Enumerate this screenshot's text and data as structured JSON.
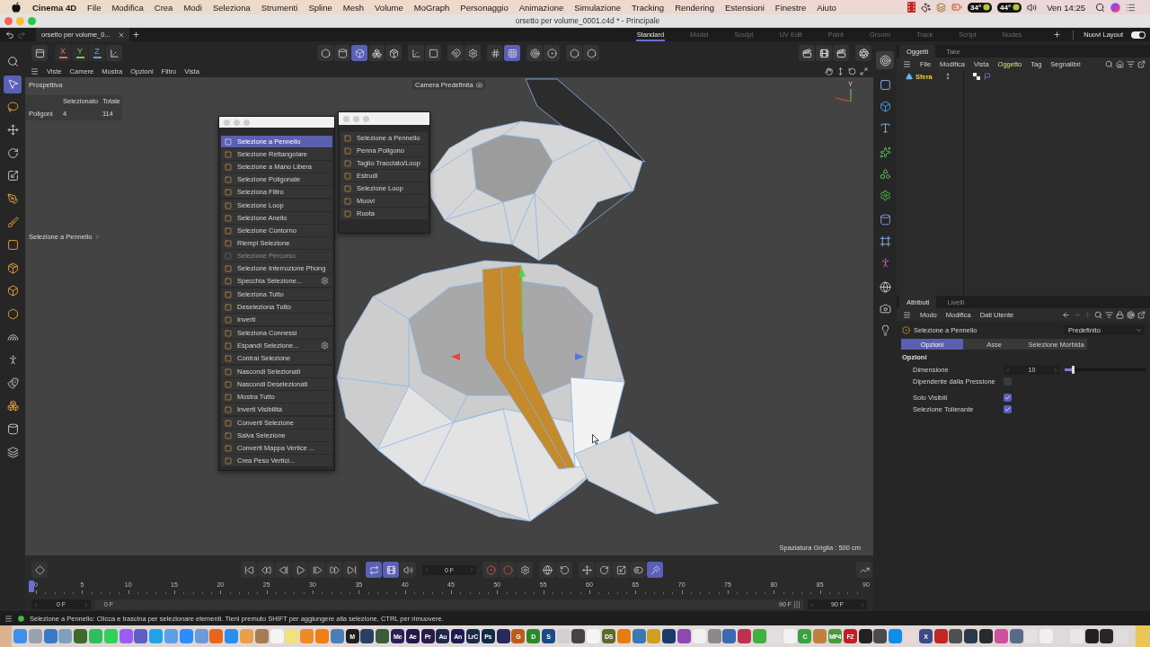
{
  "menu_bar": {
    "app": "Cinema 4D",
    "menus": [
      "File",
      "Modifica",
      "Crea",
      "Modi",
      "Seleziona",
      "Strumenti",
      "Spline",
      "Mesh",
      "Volume",
      "MoGraph",
      "Personaggio",
      "Animazione",
      "Simulazione",
      "Tracking",
      "Rendering",
      "Estensioni",
      "Finestre",
      "Aiuto"
    ],
    "sensors": [
      "34°",
      "44°"
    ],
    "clock": "Ven 14:25"
  },
  "window": {
    "title": "orsetto per volume_0001.c4d * - Principale"
  },
  "doc_tabs": [
    {
      "label": "orsetto per volume_0...",
      "selected": true
    }
  ],
  "layouts": [
    {
      "label": "Standard",
      "selected": true
    },
    {
      "label": "Model",
      "selected": false
    },
    {
      "label": "Sculpt",
      "selected": false
    },
    {
      "label": "UV Edit",
      "selected": false
    },
    {
      "label": "Paint",
      "selected": false
    },
    {
      "label": "Groom",
      "selected": false
    },
    {
      "label": "Track",
      "selected": false
    },
    {
      "label": "Script",
      "selected": false
    },
    {
      "label": "Nodes",
      "selected": false
    }
  ],
  "layout_switch": {
    "label": "Nuovi Layout",
    "on": true
  },
  "left_tools": [
    {
      "kind": "search",
      "selected": false
    },
    {
      "kind": "cursor",
      "selected": true
    },
    {
      "kind": "lasso",
      "selected": false
    },
    {
      "kind": "move",
      "selected": false
    },
    {
      "kind": "rotate",
      "selected": false
    },
    {
      "kind": "scale",
      "selected": false
    },
    {
      "kind": "pen",
      "selected": false
    },
    {
      "kind": "brush",
      "selected": false
    },
    {
      "kind": "square",
      "selected": false
    },
    {
      "kind": "package",
      "selected": false
    },
    {
      "kind": "cube",
      "selected": false
    },
    {
      "kind": "hexagon",
      "selected": false
    },
    {
      "kind": "arch",
      "selected": false
    },
    {
      "kind": "person",
      "selected": false
    },
    {
      "kind": "mask",
      "selected": false
    },
    {
      "kind": "boxes",
      "selected": false
    },
    {
      "kind": "cylinder",
      "selected": false
    },
    {
      "kind": "layers",
      "selected": false
    }
  ],
  "viewport": {
    "axis_locks": [
      {
        "label": "X",
        "color": "#e46a6a"
      },
      {
        "label": "Y",
        "color": "#7cc85a"
      },
      {
        "label": "Z",
        "color": "#6a9ae8"
      }
    ],
    "mode_groups": [
      [
        {
          "kind": "hexagon",
          "selected": false
        },
        {
          "kind": "cylinder",
          "selected": false
        },
        {
          "kind": "cube",
          "selected": true
        },
        {
          "kind": "boxes",
          "selected": false
        },
        {
          "kind": "package",
          "selected": false
        }
      ],
      [
        {
          "kind": "axis",
          "selected": false
        },
        {
          "kind": "square",
          "selected": false
        }
      ],
      [
        {
          "kind": "magnet",
          "selected": false
        },
        {
          "kind": "settings",
          "selected": false
        }
      ],
      [
        {
          "kind": "hash",
          "selected": false
        },
        {
          "kind": "grid",
          "selected": true
        }
      ],
      [
        {
          "kind": "target",
          "selected": false
        },
        {
          "kind": "circledot",
          "selected": false
        }
      ],
      [
        {
          "kind": "hexagon",
          "selected": false
        },
        {
          "kind": "hexagon",
          "selected": false
        }
      ]
    ],
    "menus": [
      "Viste",
      "Camere",
      "Mostra",
      "Opzioni",
      "Filtro",
      "Vista"
    ],
    "view_name": "Prospettiva",
    "camera": "Camera Predefinita",
    "stats": {
      "columns": [
        "Selezionato",
        "Totale"
      ],
      "rows": [
        {
          "label": "Poligoni",
          "values": [
            "4",
            "114"
          ]
        }
      ]
    },
    "tool_hint": "Selezione a Pennello",
    "gizmo_label": "Y",
    "grid_spacing": "Spaziatura Griglia : 500 cm"
  },
  "palettes": [
    {
      "groups": [
        [
          {
            "label": "Selezione a Pennello",
            "selected": true,
            "disabled": false,
            "settings": false
          },
          {
            "label": "Selezione Rettangolare",
            "selected": false,
            "disabled": false,
            "settings": false
          },
          {
            "label": "Selezione a Mano Libera",
            "selected": false,
            "disabled": false,
            "settings": false
          },
          {
            "label": "Selezione Poligonale",
            "selected": false,
            "disabled": false,
            "settings": false
          },
          {
            "label": "Seleziona Filtro",
            "selected": false,
            "disabled": false,
            "settings": false
          }
        ],
        [
          {
            "label": "Selezione Loop",
            "selected": false,
            "disabled": false,
            "settings": false
          },
          {
            "label": "Selezione Anello",
            "selected": false,
            "disabled": false,
            "settings": false
          },
          {
            "label": "Selezione Contorno",
            "selected": false,
            "disabled": false,
            "settings": false
          },
          {
            "label": "Riempi Selezione",
            "selected": false,
            "disabled": false,
            "settings": false
          },
          {
            "label": "Selezione Percorso",
            "selected": false,
            "disabled": true,
            "settings": false
          },
          {
            "label": "Selezione Interruzione Phong",
            "selected": false,
            "disabled": false,
            "settings": false
          },
          {
            "label": "Specchia Selezione...",
            "selected": false,
            "disabled": false,
            "settings": true
          }
        ],
        [
          {
            "label": "Seleziona Tutto",
            "selected": false,
            "disabled": false,
            "settings": false
          },
          {
            "label": "Deseleziona Tutto",
            "selected": false,
            "disabled": false,
            "settings": false
          },
          {
            "label": "Inverti",
            "selected": false,
            "disabled": false,
            "settings": false
          }
        ],
        [
          {
            "label": "Seleziona Connessi",
            "selected": false,
            "disabled": false,
            "settings": false
          },
          {
            "label": "Espandi Selezione...",
            "selected": false,
            "disabled": false,
            "settings": true
          },
          {
            "label": "Contrai Selezione",
            "selected": false,
            "disabled": false,
            "settings": false
          }
        ],
        [
          {
            "label": "Nascondi Selezionati",
            "selected": false,
            "disabled": false,
            "settings": false
          },
          {
            "label": "Nascondi Deselezionati",
            "selected": false,
            "disabled": false,
            "settings": false
          },
          {
            "label": "Mostra Tutto",
            "selected": false,
            "disabled": false,
            "settings": false
          },
          {
            "label": "Inverti Visibilità",
            "selected": false,
            "disabled": false,
            "settings": false
          }
        ],
        [
          {
            "label": "Converti Selezione",
            "selected": false,
            "disabled": false,
            "settings": false
          },
          {
            "label": "Salva Selezione",
            "selected": false,
            "disabled": false,
            "settings": false
          },
          {
            "label": "Converti Mappa Vertice ...",
            "selected": false,
            "disabled": false,
            "settings": false
          },
          {
            "label": "Crea Peso Vertici...",
            "selected": false,
            "disabled": false,
            "settings": false
          }
        ]
      ]
    },
    {
      "groups": [
        [
          {
            "label": "Selezione a Pennello",
            "selected": false
          },
          {
            "label": "Penna Poligono",
            "selected": false
          },
          {
            "label": "Taglio Tracciato/Loop",
            "selected": false
          },
          {
            "label": "Estrudi",
            "selected": false
          },
          {
            "label": "Selezione Loop",
            "selected": false
          },
          {
            "label": "Muovi",
            "selected": false
          },
          {
            "label": "Ruota",
            "selected": false
          }
        ]
      ]
    }
  ],
  "right_tools": [
    [
      {
        "kind": "target",
        "selected": true
      }
    ],
    [
      {
        "kind": "outline",
        "selected": false
      },
      {
        "kind": "primitive",
        "selected": false
      },
      {
        "kind": "text",
        "selected": false
      }
    ],
    [
      {
        "kind": "sparkles",
        "selected": false
      },
      {
        "kind": "shapes",
        "selected": false
      },
      {
        "kind": "gear",
        "selected": false
      }
    ],
    [
      {
        "kind": "capsule",
        "selected": false
      },
      {
        "kind": "frame",
        "selected": false
      },
      {
        "kind": "figure",
        "selected": false
      }
    ],
    [
      {
        "kind": "globe",
        "selected": false
      },
      {
        "kind": "camera",
        "selected": false
      },
      {
        "kind": "light",
        "selected": false
      }
    ]
  ],
  "objects_panel": {
    "tabs": [
      {
        "label": "Oggetti",
        "selected": true
      },
      {
        "label": "Take",
        "selected": false
      }
    ],
    "menus": [
      {
        "label": "File",
        "active": false
      },
      {
        "label": "Modifica",
        "active": false
      },
      {
        "label": "Vista",
        "active": false
      },
      {
        "label": "Oggetto",
        "active": true
      },
      {
        "label": "Tag",
        "active": false
      },
      {
        "label": "Segnalibri",
        "active": false
      }
    ],
    "objects": [
      {
        "label": "Sfera",
        "selected": true
      }
    ]
  },
  "attributes_panel": {
    "tabs": [
      {
        "label": "Attributi",
        "selected": true
      },
      {
        "label": "Livelli",
        "selected": false
      }
    ],
    "menus": [
      "Modo",
      "Modifica",
      "Dati Utente"
    ],
    "tool": "Selezione a Pennello",
    "preset": "Predefinito",
    "subtabs": [
      {
        "label": "Opzioni",
        "selected": true
      },
      {
        "label": "Asse",
        "selected": false
      },
      {
        "label": "Selezione Morbida",
        "selected": false
      }
    ],
    "section": "Opzioni",
    "field_groups": [
      [
        {
          "kind": "slider",
          "label": "Dimensione",
          "value": "10",
          "level": 0.1
        },
        {
          "kind": "checkbox",
          "label": "Dipendente dalla Pressione",
          "checked": false
        }
      ],
      [
        {
          "kind": "checkbox",
          "label": "Solo Visibili",
          "checked": true
        },
        {
          "kind": "checkbox",
          "label": "Selezione Tollerante",
          "checked": true
        }
      ]
    ]
  },
  "timeline": {
    "groups": [
      [
        {
          "kind": "key",
          "selected": false
        }
      ],
      [
        {
          "kind": "first",
          "selected": false
        },
        {
          "kind": "rewind",
          "selected": false
        },
        {
          "kind": "prev",
          "selected": false
        },
        {
          "kind": "play",
          "selected": false
        },
        {
          "kind": "next",
          "selected": false
        },
        {
          "kind": "forward",
          "selected": false
        },
        {
          "kind": "last",
          "selected": false
        }
      ],
      [
        {
          "kind": "loop",
          "selected": true
        },
        {
          "kind": "film",
          "selected": true
        },
        {
          "kind": "sound",
          "selected": false
        }
      ],
      [
        {
          "kind": "field",
          "value": "0 F"
        }
      ],
      [
        {
          "kind": "record",
          "selected": false
        },
        {
          "kind": "autokey",
          "selected": false
        },
        {
          "kind": "settings",
          "selected": false
        }
      ],
      [
        {
          "kind": "orbit",
          "selected": false
        },
        {
          "kind": "rotate_ccw",
          "selected": false
        }
      ],
      [
        {
          "kind": "move",
          "selected": false
        },
        {
          "kind": "rotate",
          "selected": false
        },
        {
          "kind": "scale",
          "selected": false
        },
        {
          "kind": "toggle",
          "selected": false
        },
        {
          "kind": "wand",
          "selected": true
        }
      ],
      [
        {
          "kind": "graph",
          "selected": false
        }
      ]
    ],
    "ruler": [
      "0",
      "5",
      "10",
      "15",
      "20",
      "25",
      "30",
      "35",
      "40",
      "45",
      "50",
      "55",
      "60",
      "65",
      "70",
      "75",
      "80",
      "85",
      "90"
    ],
    "playhead": {
      "level": 0
    },
    "range": {
      "start_field": "0 F",
      "start": "0 F",
      "end": "90 F",
      "end_field": "90 F"
    }
  },
  "status_text": "Selezione a Pennello: Clicca e trascina per selezionare elementi. Tieni premuto SHIFT per aggiungere alla selezione, CTRL per rimuovere.",
  "dock": [
    {
      "color": "#3d8fe8"
    },
    {
      "color": "#9aa0ad"
    },
    {
      "color": "#3a78c8"
    },
    {
      "color": "#7f9fbf"
    },
    {
      "color": "#3f6a2a"
    },
    {
      "color": "#2dbe60"
    },
    {
      "color": "#2fd15a"
    },
    {
      "color": "#9b5cf6"
    },
    {
      "color": "#5b5fc7"
    },
    {
      "color": "#1fa3e8"
    },
    {
      "color": "#5aa0e8"
    },
    {
      "color": "#2d8cff"
    },
    {
      "color": "#6a9ad8"
    },
    {
      "color": "#e8661a"
    },
    {
      "color": "#2a8ef0"
    },
    {
      "color": "#e8a04a"
    },
    {
      "color": "#a67c52"
    },
    {
      "color": "#f4f4f4"
    },
    {
      "color": "#f3e17a"
    },
    {
      "color": "#f08a24"
    },
    {
      "color": "#f07f10"
    },
    {
      "color": "#4a7fb5"
    },
    {
      "color": "#1e1e1e",
      "label": "M"
    },
    {
      "color": "#2b3f63"
    },
    {
      "color": "#3b5b3b"
    },
    {
      "color": "#2a1f5c",
      "label": "Me"
    },
    {
      "color": "#1f1a4a",
      "label": "Ae"
    },
    {
      "color": "#2a1a4a",
      "label": "Pr"
    },
    {
      "color": "#1f2a4a",
      "label": "Au"
    },
    {
      "color": "#1f1a50",
      "label": "An"
    },
    {
      "color": "#1a2a4a",
      "label": "LrC"
    },
    {
      "color": "#0f2a4a",
      "label": "Ps"
    },
    {
      "color": "#2a2a5a"
    },
    {
      "color": "#c05a1a",
      "label": "G"
    },
    {
      "color": "#2a8a2a",
      "label": "D"
    },
    {
      "color": "#1a4a8a",
      "label": "S"
    },
    {
      "color": "#d0d0d0"
    },
    {
      "color": "#444444"
    },
    {
      "color": "#f5f5f5"
    },
    {
      "color": "#5a6a2a",
      "label": "DS"
    },
    {
      "color": "#e87d0d"
    },
    {
      "color": "#3a7ab0"
    },
    {
      "color": "#d0a020"
    },
    {
      "color": "#1a3a6a"
    },
    {
      "color": "#8a4ab0"
    },
    {
      "color": "#f0f0f0"
    },
    {
      "color": "#8a8a8a"
    },
    {
      "color": "#3a6ab0"
    },
    {
      "color": "#c03050"
    },
    {
      "color": "#40b040"
    },
    {
      "color": "#e0e0e0"
    },
    {
      "color": "#f2f2f2"
    },
    {
      "color": "#3aa040",
      "label": "C"
    },
    {
      "color": "#c08040"
    },
    {
      "color": "#4a9a3a",
      "label": "MP4"
    },
    {
      "color": "#c02020",
      "label": "FZ"
    },
    {
      "color": "#222222"
    },
    {
      "color": "#4a4a4a"
    },
    {
      "color": "#0e8ee9"
    },
    {
      "color": "#e8d8d8"
    },
    {
      "color": "#3a4a8a",
      "label": "X"
    },
    {
      "color": "#c42424"
    },
    {
      "color": "#505050"
    },
    {
      "color": "#2a3a4a"
    },
    {
      "color": "#2a2a2a"
    },
    {
      "color": "#d050a0"
    },
    {
      "color": "#5a6a8a"
    },
    {
      "color": "#e2e2e2"
    },
    {
      "color": "#efefef"
    },
    {
      "color": "#dcdcdc"
    },
    {
      "color": "#e8e8e8"
    },
    {
      "color": "#202020"
    },
    {
      "color": "#262626"
    },
    {
      "color": "#dddddd"
    }
  ]
}
